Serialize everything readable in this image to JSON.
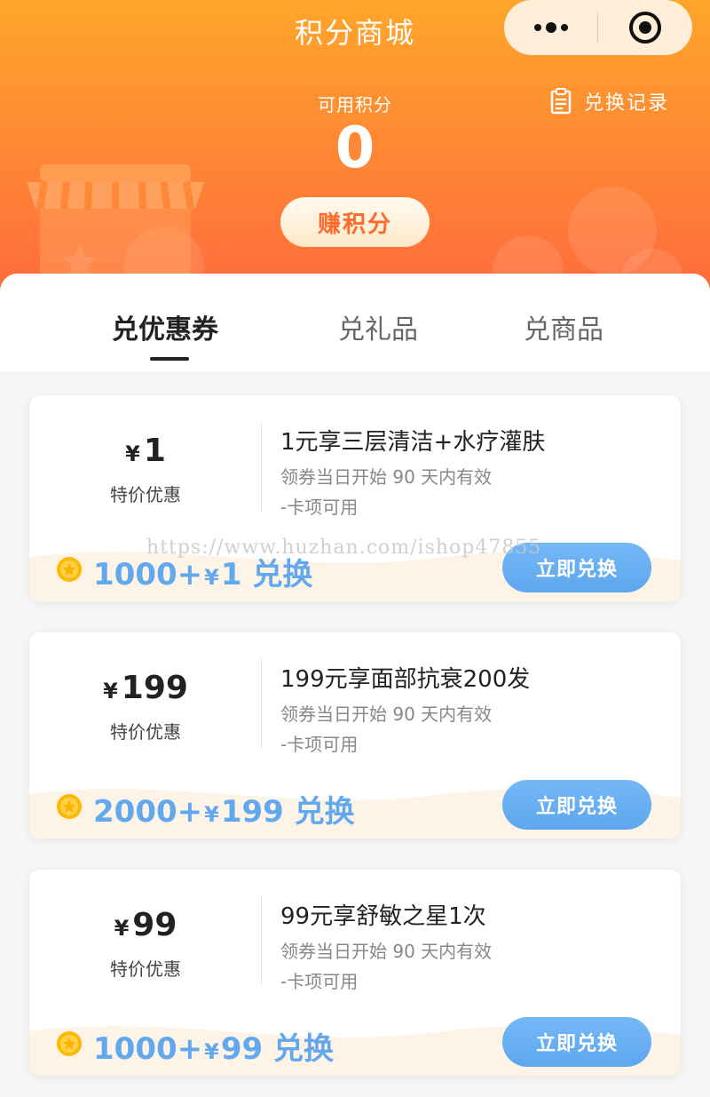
{
  "header": {
    "title": "积分商城",
    "points_label": "可用积分",
    "points_value": "0",
    "history_label": "兑换记录",
    "earn_label": "赚积分"
  },
  "tabs": [
    {
      "label": "兑优惠券",
      "active": true
    },
    {
      "label": "兑礼品",
      "active": false
    },
    {
      "label": "兑商品",
      "active": false
    }
  ],
  "cards": [
    {
      "currency": "¥",
      "price": "1",
      "price_label": "特价优惠",
      "title": "1元享三层清洁+水疗灌肤",
      "validity": "领券当日开始 90 天内有效",
      "scope": "-卡项可用",
      "cost_points": "1000+",
      "cost_currency": "¥",
      "cost_price": "1",
      "cost_suffix": "兑换",
      "button": "立即兑换"
    },
    {
      "currency": "¥",
      "price": "199",
      "price_label": "特价优惠",
      "title": "199元享面部抗衰200发",
      "validity": "领券当日开始 90 天内有效",
      "scope": "-卡项可用",
      "cost_points": "2000+",
      "cost_currency": "¥",
      "cost_price": "199",
      "cost_suffix": "兑换",
      "button": "立即兑换"
    },
    {
      "currency": "¥",
      "price": "99",
      "price_label": "特价优惠",
      "title": "99元享舒敏之星1次",
      "validity": "领券当日开始 90 天内有效",
      "scope": "-卡项可用",
      "cost_points": "1000+",
      "cost_currency": "¥",
      "cost_price": "99",
      "cost_suffix": "兑换",
      "button": "立即兑换"
    }
  ],
  "watermark": "https://www.huzhan.com/ishop47855",
  "colors": {
    "header_top": "#ffa62a",
    "header_bottom": "#ff6a3d",
    "accent_blue": "#61a8ee",
    "earn_text": "#ff6a2a"
  },
  "icons": {
    "capsule_more": "more-dots-icon",
    "capsule_close": "target-close-icon",
    "history": "clipboard-icon",
    "coin": "coin-star-icon"
  }
}
